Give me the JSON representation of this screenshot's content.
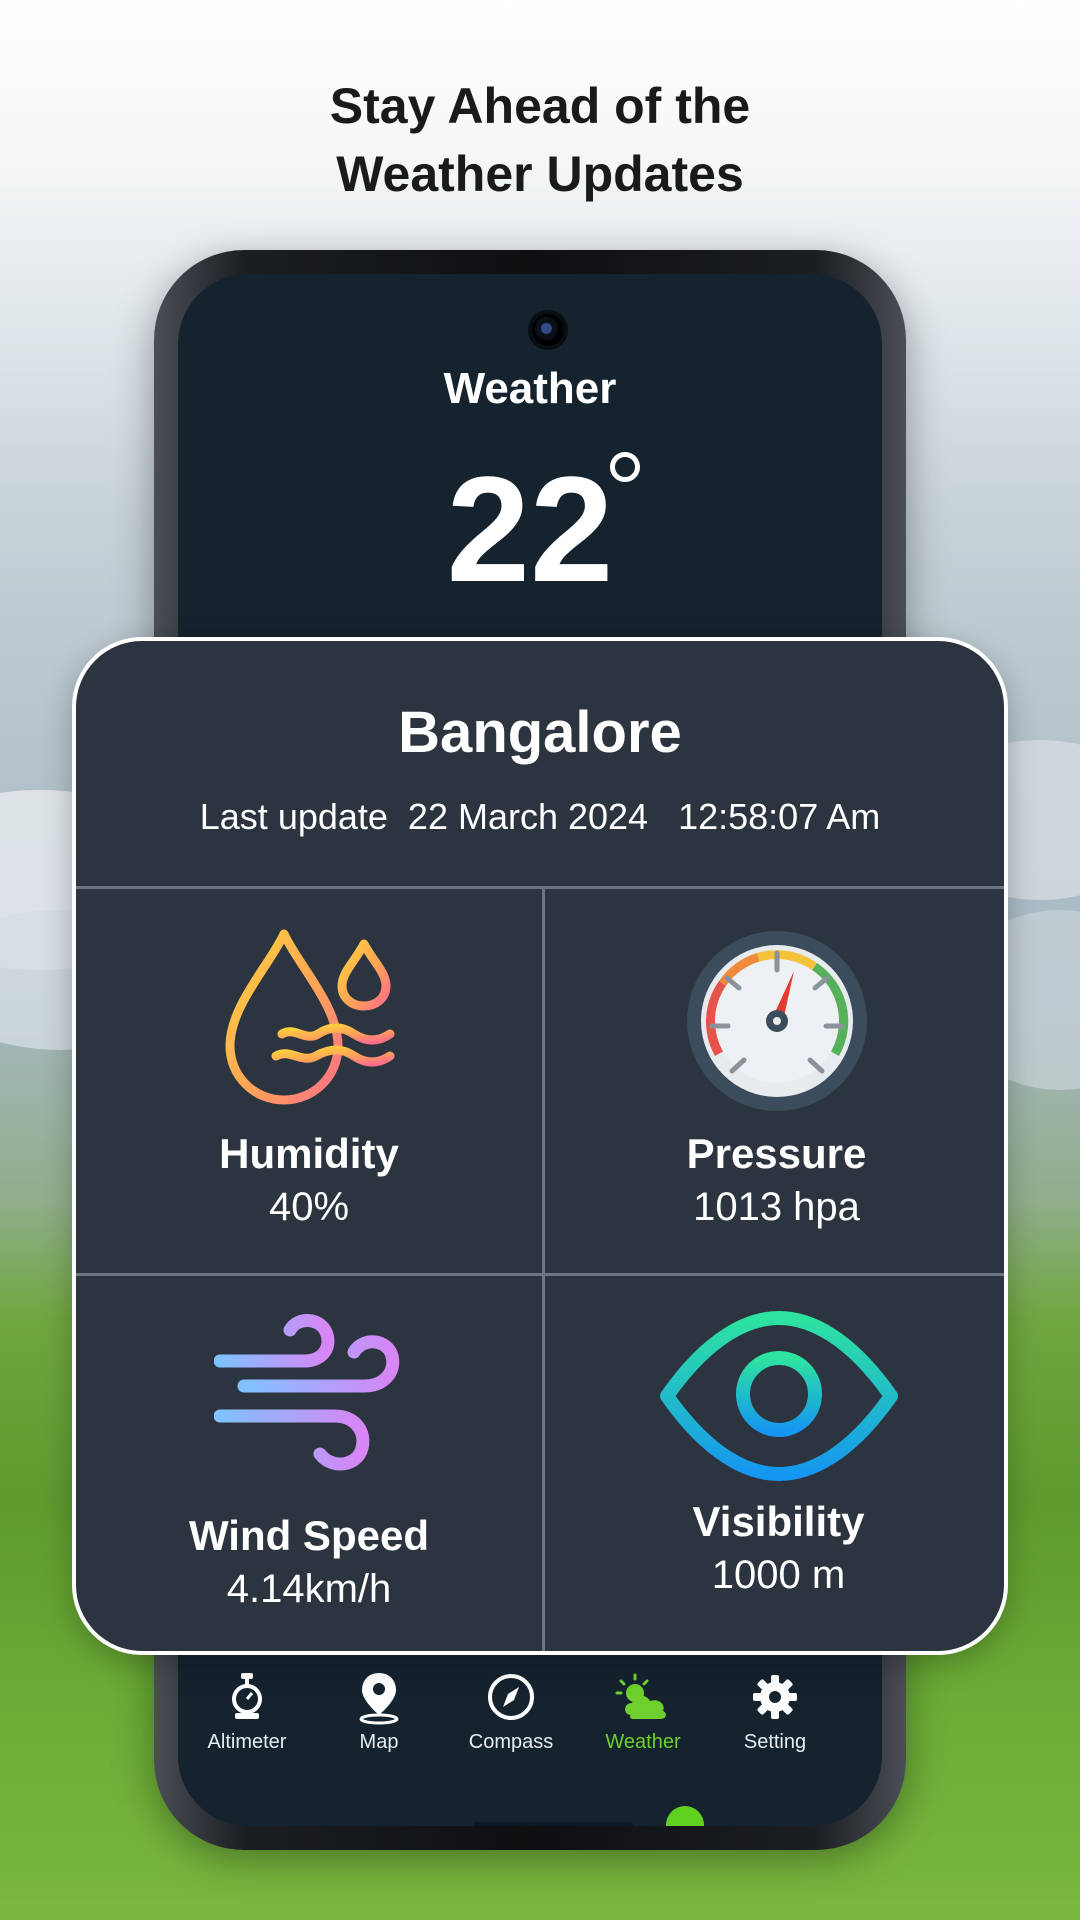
{
  "promo": {
    "headline_line1": "Stay Ahead of the",
    "headline_line2": "Weather Updates"
  },
  "screen": {
    "title": "Weather",
    "temperature": "22"
  },
  "card": {
    "city": "Bangalore",
    "last_update": "Last update  22 March 2024   12:58:07 Am",
    "metrics": [
      {
        "label": "Humidity",
        "value": "40%",
        "icon": "humidity-icon"
      },
      {
        "label": "Pressure",
        "value": "1013 hpa",
        "icon": "pressure-gauge-icon"
      },
      {
        "label": "Wind Speed",
        "value": "4.14km/h",
        "icon": "wind-icon"
      },
      {
        "label": "Visibility",
        "value": "1000 m",
        "icon": "eye-icon"
      }
    ]
  },
  "nav": {
    "items": [
      {
        "label": "Altimeter",
        "icon": "altimeter-icon"
      },
      {
        "label": "Map",
        "icon": "map-pin-icon"
      },
      {
        "label": "Compass",
        "icon": "compass-icon"
      },
      {
        "label": "Weather",
        "icon": "weather-icon",
        "active": true
      },
      {
        "label": "Setting",
        "icon": "gear-icon"
      }
    ],
    "active_color": "#6fcf2f"
  },
  "colors": {
    "screen_bg": "#15232f",
    "card_bg": "#2c353f",
    "accent": "#5fd11e"
  }
}
